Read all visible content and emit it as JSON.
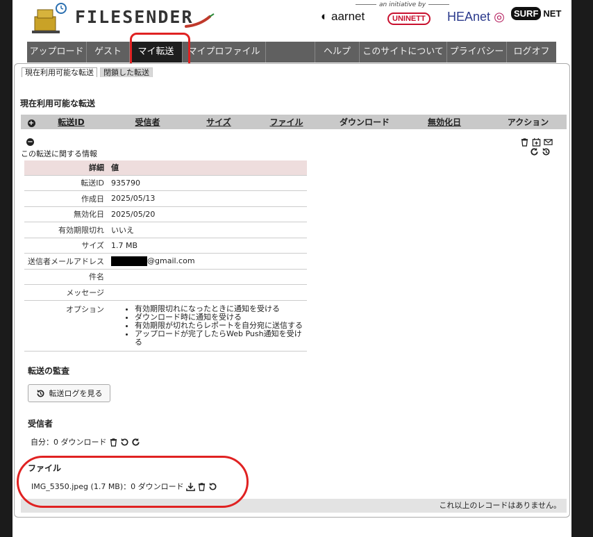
{
  "header": {
    "logo_text": "FILESENDER",
    "initiative": "an initiative by",
    "partners": {
      "aarnet": "aarnet",
      "uninett": "UNINETT",
      "heanet": "HEAnet",
      "surf_a": "SURF",
      "surf_b": "NET"
    }
  },
  "nav": {
    "items": [
      {
        "label": "アップロード"
      },
      {
        "label": "ゲスト"
      },
      {
        "label": "マイ転送"
      },
      {
        "label": "マイプロファイル"
      },
      {
        "label": "ヘルプ"
      },
      {
        "label": "このサイトについて"
      },
      {
        "label": "プライバシー"
      },
      {
        "label": "ログオフ"
      }
    ],
    "active_index": 2
  },
  "subtabs": [
    {
      "label": "現在利用可能な転送"
    },
    {
      "label": "閉鎖した転送"
    }
  ],
  "transfers": {
    "title": "現在利用可能な転送",
    "columns": {
      "transfer_id": "転送ID",
      "recipients": "受信者",
      "size": "サイズ",
      "files": "ファイル",
      "downloads": "ダウンロード",
      "expires": "無効化日",
      "actions": "アクション"
    },
    "info_label": "この転送に関する情報",
    "detail": {
      "header_key": "詳細",
      "header_value": "値",
      "rows": [
        {
          "k": "転送ID",
          "v": "935790"
        },
        {
          "k": "作成日",
          "v": "2025/05/13"
        },
        {
          "k": "無効化日",
          "v": "2025/05/20"
        },
        {
          "k": "有効期限切れ",
          "v": "いいえ"
        },
        {
          "k": "サイズ",
          "v": "1.7 MB"
        },
        {
          "k": "送信者メールアドレス",
          "v": "@gmail.com"
        },
        {
          "k": "件名",
          "v": ""
        },
        {
          "k": "メッセージ",
          "v": ""
        }
      ],
      "options_label": "オプション",
      "options": [
        "有効期限切れになったときに通知を受ける",
        "ダウンロード時に通知を受ける",
        "有効期限が切れたらレポートを自分宛に送信する",
        "アップロードが完了したらWeb Push通知を受ける"
      ]
    },
    "audit": {
      "title": "転送の監査",
      "button": "転送ログを見る"
    },
    "recipients": {
      "title": "受信者",
      "line": "自分：0 ダウンロード"
    },
    "files": {
      "title": "ファイル",
      "line": "IMG_5350.jpeg (1.7 MB)：0 ダウンロード"
    },
    "footer": "これ以上のレコードはありません。"
  },
  "colors": {
    "annotation": "#e02222",
    "nav_bg": "#606060",
    "nav_active": "#1e1e1e",
    "detail_header": "#eedddd"
  }
}
